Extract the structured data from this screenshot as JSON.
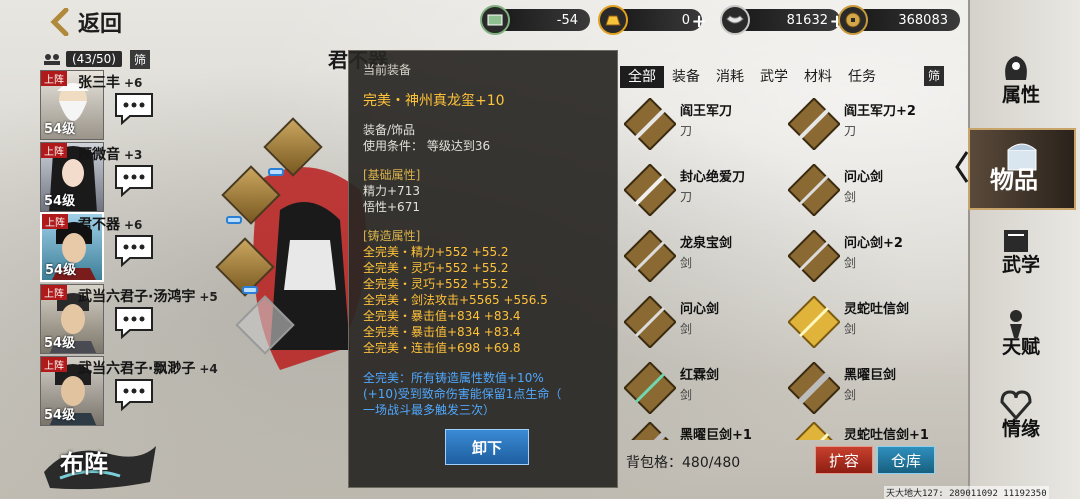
{
  "header": {
    "back_label": "返回",
    "currencies": [
      {
        "icon": "ticket-icon",
        "value": "-54"
      },
      {
        "icon": "gold-bar-icon",
        "value": "0"
      },
      {
        "icon": "silver-ingot-icon",
        "value": "81632"
      },
      {
        "icon": "coin-icon",
        "value": "368083"
      }
    ]
  },
  "roster": {
    "count": "(43/50)",
    "filter_label": "筛",
    "heroes": [
      {
        "tag": "上阵",
        "name": "张三丰",
        "bonus": "+6",
        "level": "54级"
      },
      {
        "tag": "上阵",
        "name": "顾微音",
        "bonus": "+3",
        "level": "54级"
      },
      {
        "tag": "上阵",
        "name": "君不器",
        "bonus": "+6",
        "level": "54级"
      },
      {
        "tag": "上阵",
        "name": "武当六君子·汤鸿宇",
        "bonus": "+5",
        "level": "54级"
      },
      {
        "tag": "上阵",
        "name": "武当六君子·飘渺子",
        "bonus": "+4",
        "level": "54级"
      }
    ],
    "formation_label": "布阵"
  },
  "team_title": "君不器",
  "detail": {
    "header": "当前装备",
    "name": "完美・神州真龙玺+10",
    "category": "装备/饰品",
    "requirement": "使用条件：  等级达到36",
    "base_title": "[基础属性]",
    "base_stats": [
      "精力+713",
      "悟性+671"
    ],
    "forge_title": "[铸造属性]",
    "forge_stats": [
      "全完美・精力+552  +55.2",
      "全完美・灵巧+552  +55.2",
      "全完美・灵巧+552  +55.2",
      "全完美・剑法攻击+5565  +556.5",
      "全完美・暴击值+834  +83.4",
      "全完美・暴击值+834  +83.4",
      "全完美・连击值+698  +69.8"
    ],
    "set_desc": [
      "全完美：所有铸造属性数值+10%",
      "(+10)受到致命伤害能保留1点生命（",
      "一场战斗最多触发三次）"
    ],
    "unload_label": "卸下"
  },
  "inventory": {
    "tabs": [
      "全部",
      "装备",
      "消耗",
      "武学",
      "材料",
      "任务"
    ],
    "active_tab": 0,
    "filter_label": "筛",
    "items": [
      {
        "name": "阎王军刀",
        "type": "刀",
        "icon": "blade-icon"
      },
      {
        "name": "阎王军刀+2",
        "type": "刀",
        "icon": "blade-icon"
      },
      {
        "name": "封心绝爱刀",
        "type": "刀",
        "icon": "blade-icon"
      },
      {
        "name": "问心剑",
        "type": "剑",
        "icon": "sword-icon"
      },
      {
        "name": "龙泉宝剑",
        "type": "剑",
        "icon": "sword-icon"
      },
      {
        "name": "问心剑+2",
        "type": "剑",
        "icon": "sword-icon"
      },
      {
        "name": "问心剑",
        "type": "剑",
        "icon": "sword-icon"
      },
      {
        "name": "灵蛇吐信剑",
        "type": "剑",
        "icon": "golden-sword-icon"
      },
      {
        "name": "红霖剑",
        "type": "剑",
        "icon": "jade-sword-icon"
      },
      {
        "name": "黑曜巨剑",
        "type": "剑",
        "icon": "greatsword-icon"
      },
      {
        "name": "黑曜巨剑+1",
        "type": "",
        "icon": "greatsword-icon"
      },
      {
        "name": "灵蛇吐信剑+1",
        "type": "",
        "icon": "golden-sword-icon"
      }
    ],
    "bag_label": "背包格：480/480",
    "expand_label": "扩容",
    "storage_label": "仓库"
  },
  "sidebar": {
    "items": [
      {
        "label": "属性",
        "icon": "spirit-icon"
      },
      {
        "label": "物品",
        "icon": "treasure-chest-icon"
      },
      {
        "label": "武学",
        "icon": "book-icon"
      },
      {
        "label": "天赋",
        "icon": "talent-icon"
      },
      {
        "label": "情缘",
        "icon": "heart-icon"
      }
    ],
    "active": 1
  },
  "footer": {
    "server_info": "天大地大127: 289011092  11192350"
  },
  "colors": {
    "gold": "#ffc43a",
    "blue_text": "#4fa8ff",
    "expand": "#b0301f",
    "storage": "#2480a8"
  }
}
